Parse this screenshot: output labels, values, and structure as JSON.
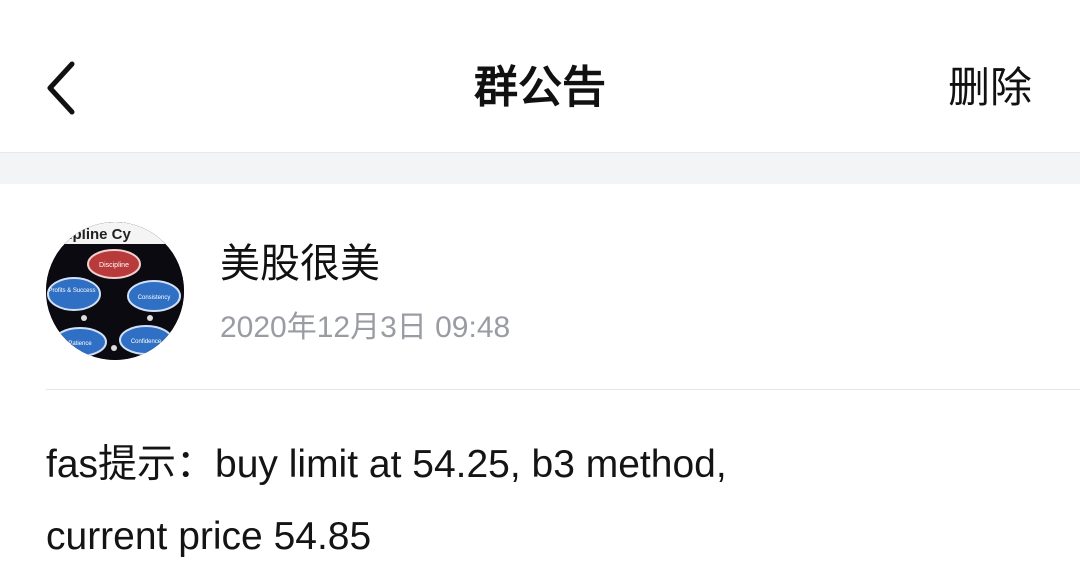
{
  "nav": {
    "back_icon": "chevron-left-icon",
    "title": "群公告",
    "delete_label": "删除"
  },
  "post": {
    "author": {
      "name": "美股很美",
      "avatar": {
        "banner_text": "cipline Cy",
        "nodes": [
          "Discipline",
          "Profits & Success",
          "Consistency",
          "Confidence",
          "Patience"
        ]
      }
    },
    "time": "2020年12月3日 09:48",
    "content_lines": [
      "fas提示：buy limit at 54.25, b3 method,",
      "current price 54.85"
    ]
  },
  "colors": {
    "background": "#ffffff",
    "separator": "#f3f4f6",
    "text_primary": "#111111",
    "text_secondary": "#9a9ca3"
  }
}
